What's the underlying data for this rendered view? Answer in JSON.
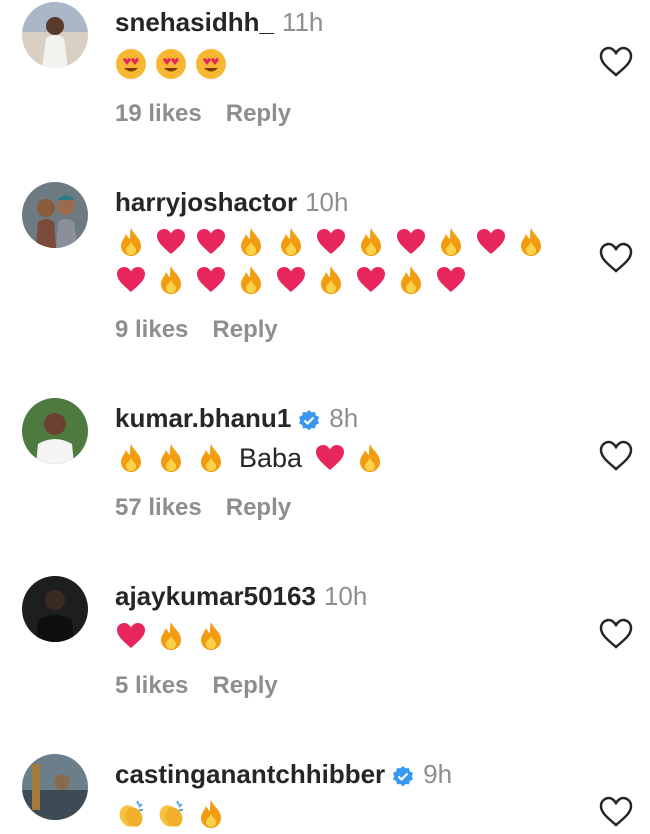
{
  "comments": [
    {
      "username": "snehasidhh_",
      "time": "11h",
      "verified": false,
      "emoji_lines": [
        [
          "heart-eyes",
          "heart-eyes",
          "heart-eyes"
        ]
      ],
      "likes": "19 likes",
      "reply": "Reply"
    },
    {
      "username": "harryjoshactor",
      "time": "10h",
      "verified": false,
      "emoji_lines": [
        [
          "fire",
          "heart",
          "heart",
          "fire",
          "fire",
          "heart",
          "fire",
          "heart",
          "fire",
          "heart",
          "fire"
        ],
        [
          "heart",
          "fire",
          "heart",
          "fire",
          "heart",
          "fire",
          "heart",
          "fire",
          "heart"
        ]
      ],
      "likes": "9 likes",
      "reply": "Reply"
    },
    {
      "username": "kumar.bhanu1",
      "time": "8h",
      "verified": true,
      "text_before": [
        "fire",
        "fire",
        "fire"
      ],
      "text": "Baba",
      "text_after": [
        "heart",
        "fire"
      ],
      "likes": "57 likes",
      "reply": "Reply"
    },
    {
      "username": "ajaykumar50163",
      "time": "10h",
      "verified": false,
      "emoji_lines": [
        [
          "heart",
          "fire",
          "fire"
        ]
      ],
      "likes": "5 likes",
      "reply": "Reply"
    },
    {
      "username": "castinganantchhibber",
      "time": "9h",
      "verified": true,
      "emoji_lines": [
        [
          "clap",
          "clap",
          "fire"
        ]
      ],
      "likes": "",
      "reply": ""
    }
  ],
  "colors": {
    "text": "#262626",
    "muted": "#8e8e8e",
    "verified": "#3897f0",
    "heart": "#e8265e",
    "fire": "#f39c12"
  },
  "icons": {
    "like": "heart-outline-icon",
    "verified": "verified-badge-icon"
  }
}
